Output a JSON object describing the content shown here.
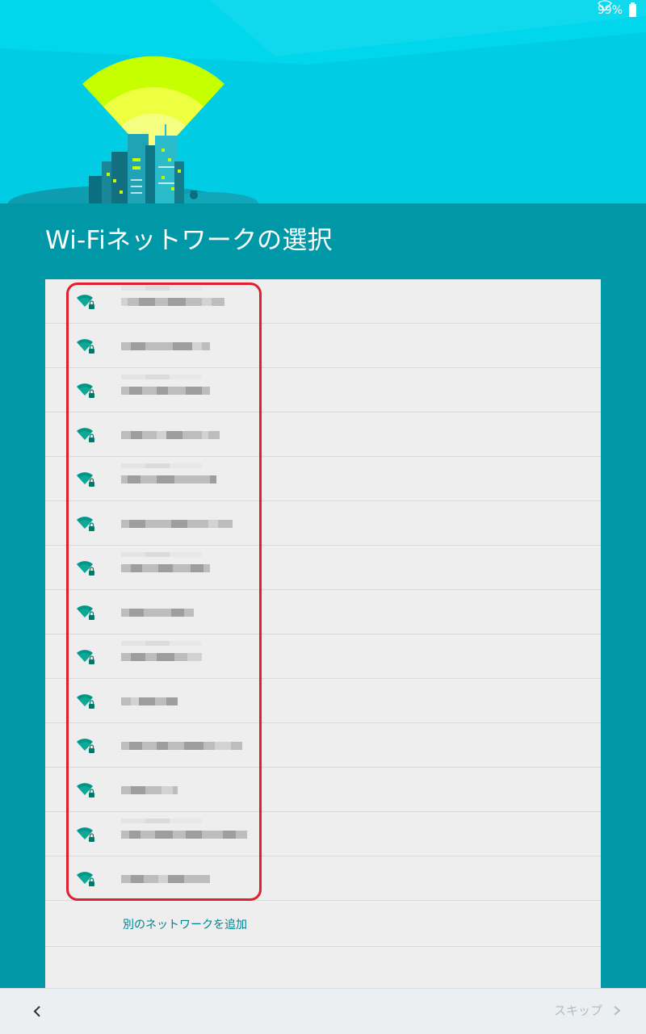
{
  "status_bar": {
    "battery_text": "99%"
  },
  "title": "Wi-Fiネットワークの選択",
  "networks": [
    {
      "icon": "wifi-lock-icon",
      "blocks": [
        [
          8,
          "l"
        ],
        [
          14,
          ""
        ],
        [
          20,
          "d"
        ],
        [
          16,
          ""
        ],
        [
          22,
          "d"
        ],
        [
          20,
          ""
        ],
        [
          12,
          "l"
        ],
        [
          16,
          ""
        ]
      ],
      "sub": true
    },
    {
      "icon": "wifi-lock-icon",
      "blocks": [
        [
          12,
          ""
        ],
        [
          18,
          "d"
        ],
        [
          14,
          ""
        ],
        [
          20,
          ""
        ],
        [
          24,
          "d"
        ],
        [
          12,
          "l"
        ],
        [
          10,
          ""
        ]
      ],
      "sub": false
    },
    {
      "icon": "wifi-lock-icon",
      "blocks": [
        [
          10,
          ""
        ],
        [
          16,
          "d"
        ],
        [
          18,
          ""
        ],
        [
          14,
          "d"
        ],
        [
          22,
          ""
        ],
        [
          20,
          "d"
        ],
        [
          10,
          ""
        ]
      ],
      "sub": true
    },
    {
      "icon": "wifi-lock-icon",
      "blocks": [
        [
          12,
          ""
        ],
        [
          14,
          "d"
        ],
        [
          18,
          ""
        ],
        [
          12,
          "l"
        ],
        [
          20,
          "d"
        ],
        [
          24,
          ""
        ],
        [
          8,
          "l"
        ],
        [
          14,
          ""
        ]
      ],
      "sub": false
    },
    {
      "icon": "wifi-lock-icon",
      "blocks": [
        [
          8,
          ""
        ],
        [
          16,
          "d"
        ],
        [
          20,
          ""
        ],
        [
          22,
          "d"
        ],
        [
          18,
          ""
        ],
        [
          26,
          ""
        ],
        [
          8,
          "d"
        ]
      ],
      "sub": true
    },
    {
      "icon": "wifi-lock-icon",
      "blocks": [
        [
          10,
          ""
        ],
        [
          20,
          "d"
        ],
        [
          14,
          ""
        ],
        [
          18,
          ""
        ],
        [
          20,
          "d"
        ],
        [
          26,
          ""
        ],
        [
          12,
          "l"
        ],
        [
          18,
          ""
        ]
      ],
      "sub": false
    },
    {
      "icon": "wifi-lock-icon",
      "blocks": [
        [
          12,
          ""
        ],
        [
          14,
          "d"
        ],
        [
          20,
          ""
        ],
        [
          18,
          "d"
        ],
        [
          22,
          ""
        ],
        [
          16,
          "d"
        ],
        [
          8,
          ""
        ]
      ],
      "sub": true
    },
    {
      "icon": "wifi-lock-icon",
      "blocks": [
        [
          10,
          ""
        ],
        [
          18,
          "d"
        ],
        [
          14,
          ""
        ],
        [
          20,
          ""
        ],
        [
          16,
          "d"
        ],
        [
          12,
          ""
        ]
      ],
      "sub": false
    },
    {
      "icon": "wifi-lock-icon",
      "blocks": [
        [
          12,
          ""
        ],
        [
          18,
          "d"
        ],
        [
          14,
          ""
        ],
        [
          22,
          "d"
        ],
        [
          16,
          ""
        ],
        [
          18,
          "l"
        ]
      ],
      "sub": true
    },
    {
      "icon": "wifi-lock-icon",
      "blocks": [
        [
          12,
          ""
        ],
        [
          10,
          "l"
        ],
        [
          20,
          "d"
        ],
        [
          14,
          ""
        ],
        [
          14,
          "d"
        ]
      ],
      "sub": false
    },
    {
      "icon": "wifi-lock-icon",
      "blocks": [
        [
          10,
          ""
        ],
        [
          16,
          "d"
        ],
        [
          18,
          ""
        ],
        [
          14,
          "d"
        ],
        [
          20,
          ""
        ],
        [
          24,
          "d"
        ],
        [
          14,
          ""
        ],
        [
          20,
          "l"
        ],
        [
          14,
          ""
        ]
      ],
      "sub": false
    },
    {
      "icon": "wifi-lock-icon",
      "blocks": [
        [
          12,
          ""
        ],
        [
          18,
          "d"
        ],
        [
          20,
          ""
        ],
        [
          14,
          "l"
        ],
        [
          6,
          ""
        ]
      ],
      "sub": false
    },
    {
      "icon": "wifi-lock-icon",
      "blocks": [
        [
          10,
          ""
        ],
        [
          14,
          "d"
        ],
        [
          18,
          ""
        ],
        [
          22,
          "d"
        ],
        [
          16,
          ""
        ],
        [
          20,
          "d"
        ],
        [
          26,
          ""
        ],
        [
          16,
          "d"
        ],
        [
          14,
          ""
        ]
      ],
      "sub": true
    },
    {
      "icon": "wifi-lock-icon",
      "blocks": [
        [
          12,
          ""
        ],
        [
          16,
          "d"
        ],
        [
          18,
          ""
        ],
        [
          12,
          "l"
        ],
        [
          20,
          "d"
        ],
        [
          20,
          ""
        ],
        [
          12,
          ""
        ]
      ],
      "sub": false
    }
  ],
  "add_network_label": "別のネットワークを追加",
  "bottom_bar": {
    "back_icon": "chevron-left-icon",
    "skip_label": "スキップ",
    "skip_icon": "chevron-right-icon"
  },
  "colors": {
    "accent": "#00838F",
    "header": "#00CDE3",
    "background": "#0097A7",
    "highlight": "#E0202F"
  }
}
